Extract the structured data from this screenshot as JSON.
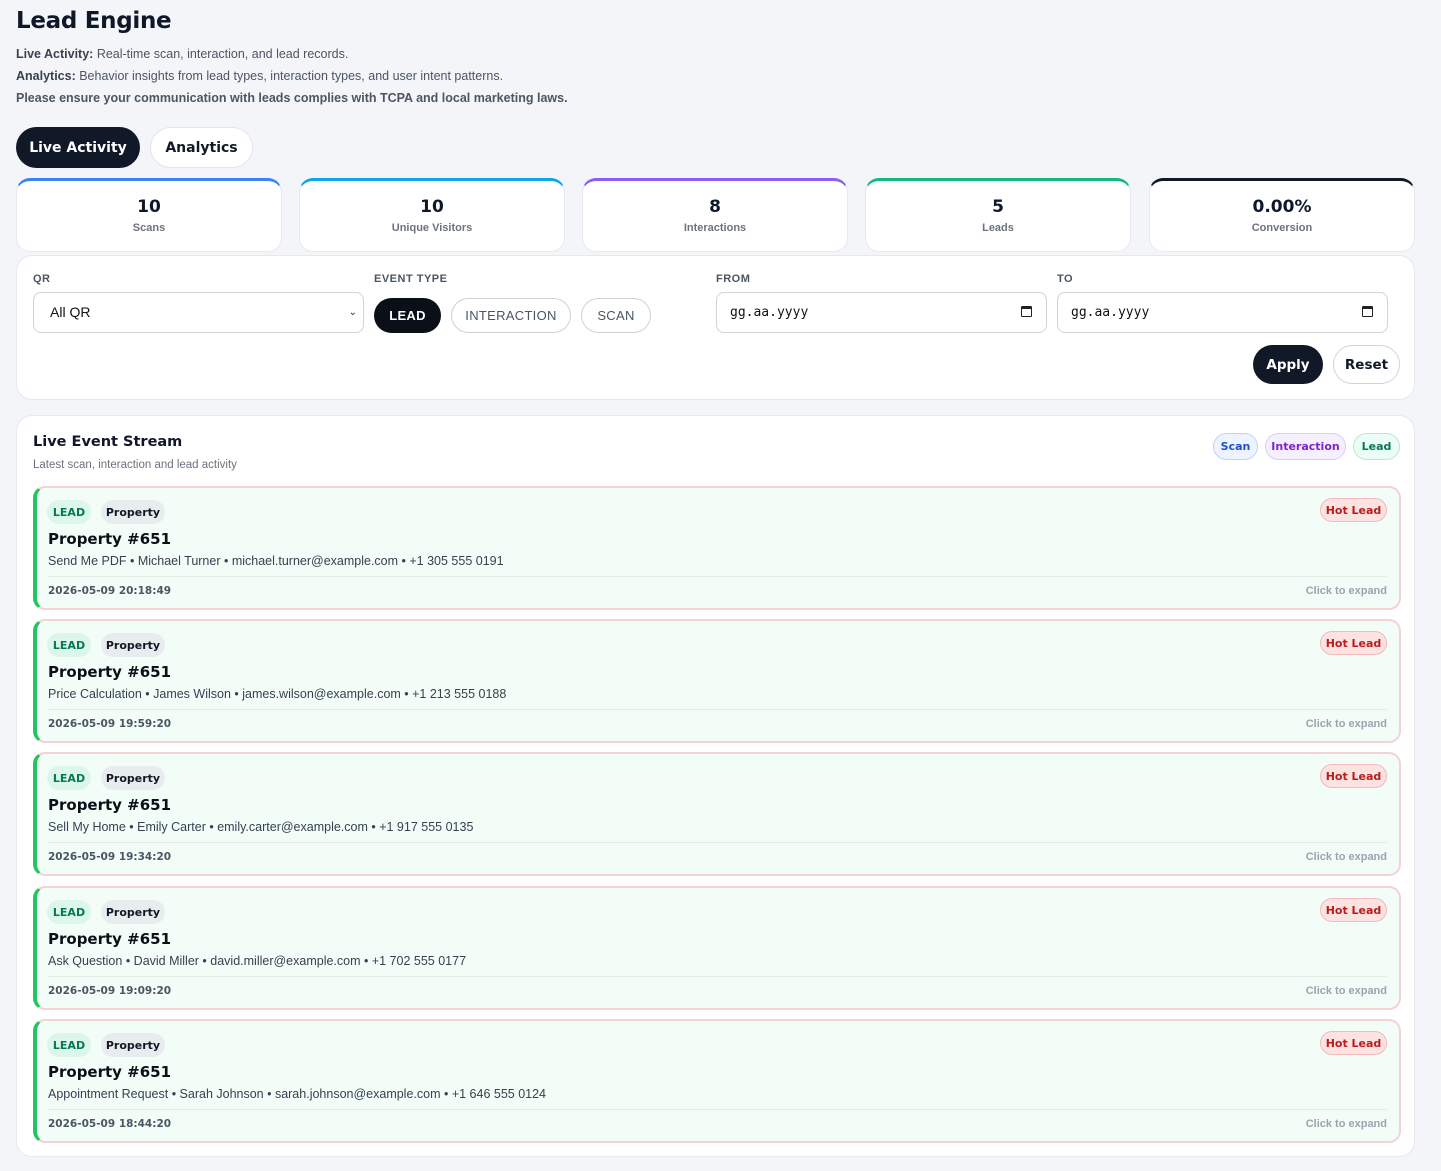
{
  "header": {
    "title": "Lead Engine",
    "desc1_label": "Live Activity:",
    "desc1_text": " Real-time scan, interaction, and lead records.",
    "desc2_label": "Analytics:",
    "desc2_text": " Behavior insights from lead types, interaction types, and user intent patterns.",
    "notice": "Please ensure your communication with leads complies with TCPA and local marketing laws."
  },
  "tabs": {
    "live": "Live Activity",
    "analytics": "Analytics"
  },
  "stats": [
    {
      "value": "10",
      "label": "Scans",
      "color": "#3b82f6"
    },
    {
      "value": "10",
      "label": "Unique Visitors",
      "color": "#0ea5e9"
    },
    {
      "value": "8",
      "label": "Interactions",
      "color": "#8b5cf6"
    },
    {
      "value": "5",
      "label": "Leads",
      "color": "#10b981"
    },
    {
      "value": "0.00%",
      "label": "Conversion",
      "color": "#111827"
    }
  ],
  "filters": {
    "qr_label": "QR",
    "qr_value": "All QR",
    "event_type_label": "EVENT TYPE",
    "event_types": [
      "LEAD",
      "INTERACTION",
      "SCAN"
    ],
    "from_label": "FROM",
    "from_placeholder": "gg.aa.yyyy",
    "to_label": "TO",
    "to_placeholder": "gg.aa.yyyy",
    "apply": "Apply",
    "reset": "Reset"
  },
  "stream": {
    "title": "Live Event Stream",
    "subtitle": "Latest scan, interaction and lead activity",
    "legend": {
      "scan": "Scan",
      "interaction": "Interaction",
      "lead": "Lead"
    },
    "common": {
      "type": "LEAD",
      "category": "Property",
      "badge": "Hot Lead",
      "expand": "Click to expand"
    },
    "events": [
      {
        "title": "Property #651",
        "detail": "Send Me PDF • Michael Turner • michael.turner@example.com • +1 305 555 0191",
        "time": "2026-05-09 20:18:49"
      },
      {
        "title": "Property #651",
        "detail": "Price Calculation • James Wilson • james.wilson@example.com • +1 213 555 0188",
        "time": "2026-05-09 19:59:20"
      },
      {
        "title": "Property #651",
        "detail": "Sell My Home • Emily Carter • emily.carter@example.com • +1 917 555 0135",
        "time": "2026-05-09 19:34:20"
      },
      {
        "title": "Property #651",
        "detail": "Ask Question • David Miller • david.miller@example.com • +1 702 555 0177",
        "time": "2026-05-09 19:09:20"
      },
      {
        "title": "Property #651",
        "detail": "Appointment Request • Sarah Johnson • sarah.johnson@example.com • +1 646 555 0124",
        "time": "2026-05-09 18:44:20"
      }
    ]
  }
}
